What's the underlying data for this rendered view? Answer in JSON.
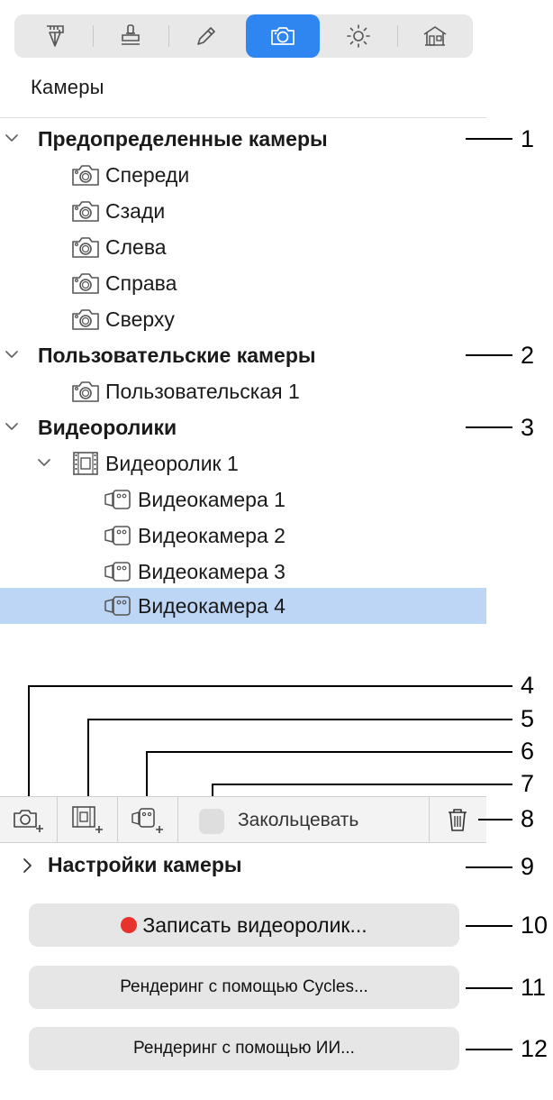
{
  "toolbar": {
    "tabs": [
      {
        "icon": "measure-icon"
      },
      {
        "icon": "stamp-icon"
      },
      {
        "icon": "pencil-icon"
      },
      {
        "icon": "camera-icon",
        "active": true
      },
      {
        "icon": "sun-icon"
      },
      {
        "icon": "house-icon"
      }
    ]
  },
  "section": {
    "title": "Камеры"
  },
  "tree": {
    "predefined": {
      "label": "Предопределенные камеры",
      "items": [
        "Спереди",
        "Сзади",
        "Слева",
        "Справа",
        "Сверху"
      ]
    },
    "user": {
      "label": "Пользовательские камеры",
      "items": [
        "Пользовательская 1"
      ]
    },
    "videos": {
      "label": "Видеоролики",
      "video": {
        "label": "Видеоролик 1",
        "cameras": [
          "Видеокамера 1",
          "Видеокамера 2",
          "Видеокамера 3",
          "Видеокамера 4"
        ],
        "selected": "Видеокамера 4"
      }
    }
  },
  "bottom_bar": {
    "loop_label": "Закольцевать",
    "icons": [
      "add-camera-icon",
      "add-video-icon",
      "add-videocamera-icon",
      "trash-icon"
    ]
  },
  "settings": {
    "label": "Настройки камеры"
  },
  "buttons": {
    "record": "Записать видеоролик...",
    "render_cycles": "Рендеринг с помощью Cycles...",
    "render_ai": "Рендеринг с помощью ИИ..."
  },
  "colors": {
    "accent": "#2f86f0",
    "selection": "#bed6f6",
    "record_dot": "#e8322d"
  },
  "callouts": [
    "1",
    "2",
    "3",
    "4",
    "5",
    "6",
    "7",
    "8",
    "9",
    "10",
    "11",
    "12"
  ]
}
